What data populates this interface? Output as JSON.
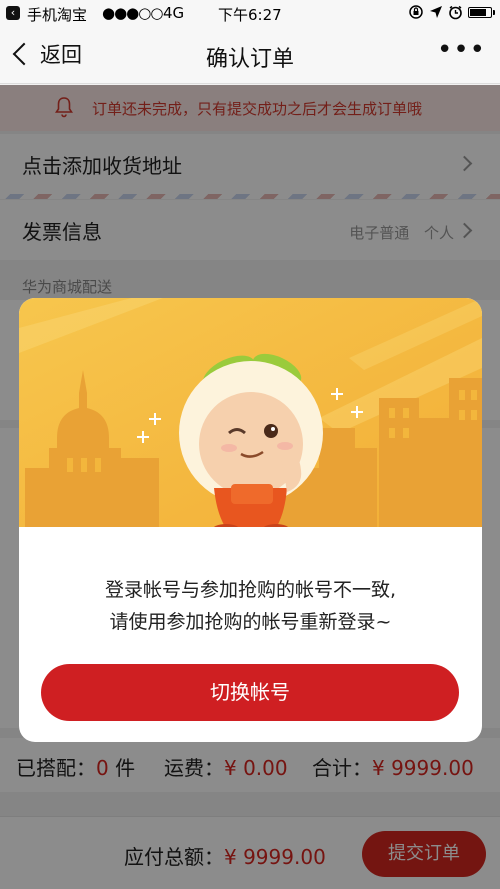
{
  "status_bar": {
    "carrier": "手机淘宝",
    "signal": "●●●○○",
    "network": "4G",
    "time": "下午6:27"
  },
  "nav": {
    "back_label": "返回",
    "title": "确认订单",
    "more_label": "•••"
  },
  "notice": {
    "text": "订单还未完成，只有提交成功之后才会生成订单哦",
    "color": "#d23a2e"
  },
  "address": {
    "label": "点击添加收货地址"
  },
  "invoice": {
    "label": "发票信息",
    "type": "电子普通",
    "title_type": "个人"
  },
  "section": {
    "label": "华为商城配送"
  },
  "summary": {
    "bundled_label": "已搭配：",
    "bundled_count": "0",
    "bundled_unit": "件",
    "shipping_label": "运费：",
    "shipping_value": "¥ 0.00",
    "total_label": "合计：",
    "total_value": "¥ 9999.00"
  },
  "footer": {
    "payable_label": "应付总额：",
    "payable_value": "¥ 9999.00",
    "submit_label": "提交订单"
  },
  "modal": {
    "line1": "登录帐号与参加抢购的帐号不一致,",
    "line2": "请使用参加抢购的帐号重新登录~",
    "button_label": "切换帐号",
    "accent": "#cf1f22",
    "hero_bg": "#f3b63c"
  }
}
